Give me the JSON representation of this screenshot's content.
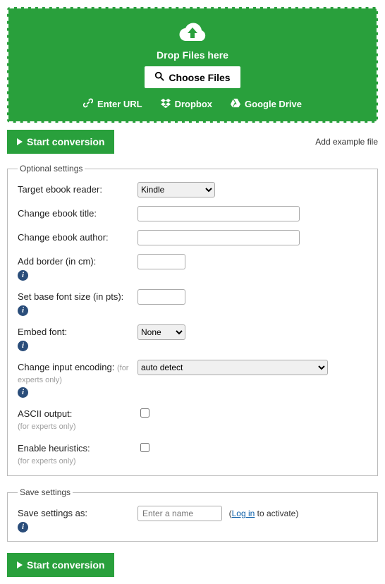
{
  "dropzone": {
    "title": "Drop Files here",
    "choose": "Choose Files",
    "enter_url": "Enter URL",
    "dropbox": "Dropbox",
    "gdrive": "Google Drive"
  },
  "actions": {
    "start": "Start conversion",
    "example": "Add example file"
  },
  "optional": {
    "legend": "Optional settings",
    "target_reader": {
      "label": "Target ebook reader:",
      "value": "Kindle"
    },
    "title": {
      "label": "Change ebook title:",
      "value": ""
    },
    "author": {
      "label": "Change ebook author:",
      "value": ""
    },
    "border": {
      "label": "Add border (in cm):",
      "value": ""
    },
    "font_size": {
      "label": "Set base font size (in pts):",
      "value": ""
    },
    "embed_font": {
      "label": "Embed font:",
      "value": "None"
    },
    "encoding": {
      "label": "Change input encoding:",
      "note": "(for experts only)",
      "value": "auto detect"
    },
    "ascii": {
      "label": "ASCII output:",
      "note": "(for experts only)"
    },
    "heuristics": {
      "label": "Enable heuristics:",
      "note": "(for experts only)"
    }
  },
  "save": {
    "legend": "Save settings",
    "label": "Save settings as:",
    "placeholder": "Enter a name",
    "note_pre": "(",
    "note_link": "Log in",
    "note_post": " to activate)"
  }
}
